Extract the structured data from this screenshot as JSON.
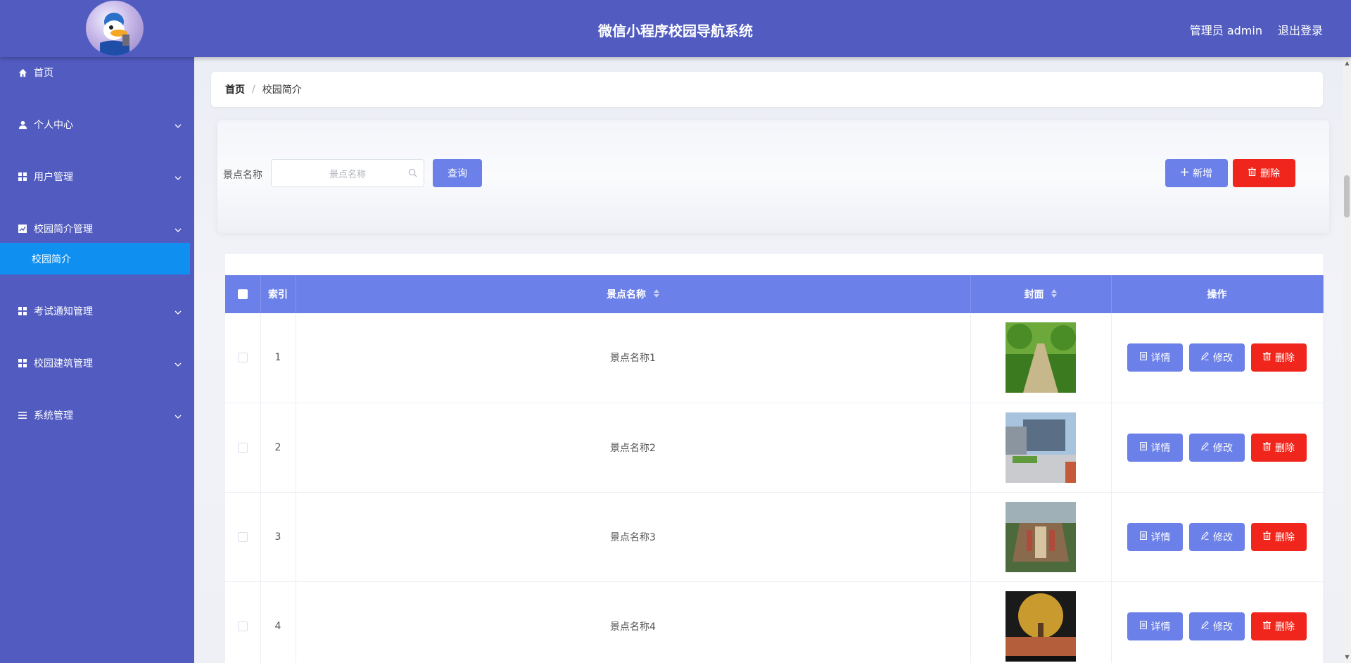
{
  "header": {
    "title": "微信小程序校园导航系统",
    "user_label": "管理员 admin",
    "logout_label": "退出登录"
  },
  "sidebar": {
    "items": [
      {
        "label": "首页",
        "icon": "home-icon"
      },
      {
        "label": "个人中心",
        "icon": "user-icon"
      },
      {
        "label": "用户管理",
        "icon": "grid-icon"
      },
      {
        "label": "校园简介管理",
        "icon": "chart-icon"
      },
      {
        "label": "考试通知管理",
        "icon": "grid-icon"
      },
      {
        "label": "校园建筑管理",
        "icon": "grid-icon"
      },
      {
        "label": "系统管理",
        "icon": "list-icon"
      }
    ],
    "active_sub": "校园简介"
  },
  "breadcrumb": {
    "home": "首页",
    "sep": "/",
    "current": "校园简介"
  },
  "search": {
    "label": "景点名称",
    "placeholder": "景点名称",
    "query_label": "查询",
    "add_label": "新增",
    "delete_label": "删除"
  },
  "table": {
    "headers": {
      "index": "索引",
      "name": "景点名称",
      "cover": "封面",
      "ops": "操作"
    },
    "rows": [
      {
        "index": "1",
        "name": "景点名称1"
      },
      {
        "index": "2",
        "name": "景点名称2"
      },
      {
        "index": "3",
        "name": "景点名称3"
      },
      {
        "index": "4",
        "name": "景点名称4"
      }
    ],
    "actions": {
      "detail": "详情",
      "edit": "修改",
      "delete": "删除"
    }
  },
  "colors": {
    "primary": "#525cc0",
    "accent": "#6b80e8",
    "danger": "#f0261c",
    "active": "#0f8ff0"
  }
}
